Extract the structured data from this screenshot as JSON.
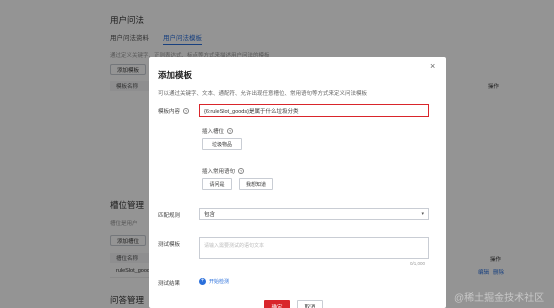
{
  "background": {
    "section_title": "用户问法",
    "tabs": [
      "用户问法资料",
      "用户问法模板"
    ],
    "hint": "通过定义关键字、正则表达式、标点等方式来描述用户问法的模板",
    "add_template_button": "添加模板",
    "table_header": "模板名称",
    "slot_section_title": "槽位管理",
    "slot_hint": "槽位是用户",
    "add_slot_button": "添加槽位",
    "slot_table_header": "槽位名称",
    "slot_row_value": "ruleSlot_goods",
    "slot_row_ops": [
      "编辑",
      "删除"
    ],
    "op_column_label": "操作",
    "bottom_section_title": "问答管理"
  },
  "dialog": {
    "title": "添加模板",
    "close_label": "×",
    "description": "可以通过关键字、文本、通配符、允许出现任意槽位、常用语句等方式来定义问法模板",
    "template_label": "模板内容",
    "template_value": "{6:ruleSlot_goods}是属于什么垃圾分类",
    "insert_slot_label": "插入槽位",
    "insert_slot_button": "垃圾物品",
    "insert_common_label": "插入常用语句",
    "common_buttons": [
      "请问是",
      "我想知道"
    ],
    "match_rule_label": "匹配规则",
    "match_rule_value": "包含",
    "test_text_label": "测试模板",
    "test_placeholder": "请输入需要测试的语句文本",
    "counter": "0/1,000",
    "test_result_label": "测试结果",
    "add_test_link": "开始检测",
    "confirm_button": "确定",
    "cancel_button": "取消"
  },
  "watermark": "@稀土掘金技术社区",
  "colors": {
    "accent_red": "#d9252b",
    "link_blue": "#2a6fdb"
  }
}
